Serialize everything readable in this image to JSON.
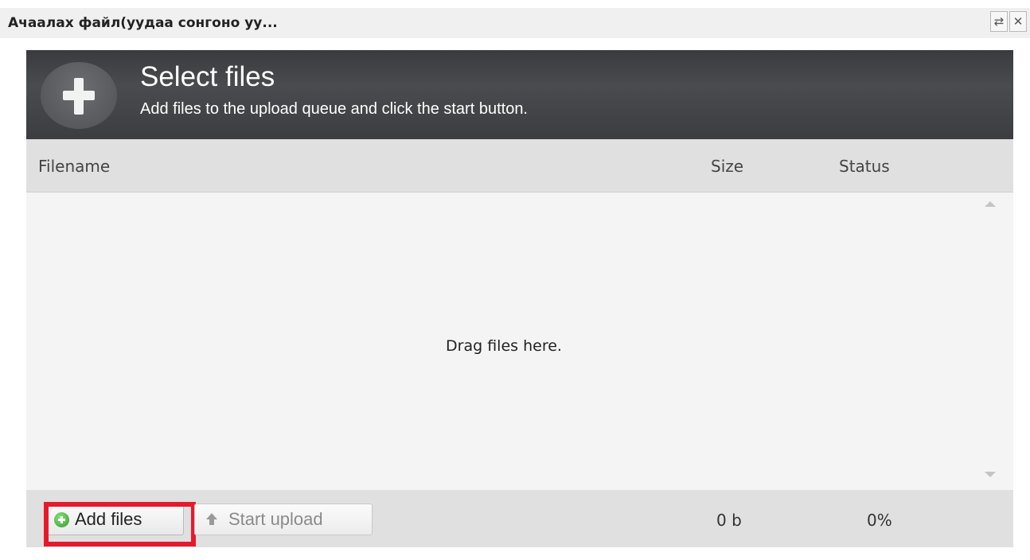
{
  "window": {
    "title": "Ачаалах файл(уудаа сонгоно уу...",
    "refresh_icon": "⇄",
    "close_icon": "✕"
  },
  "header": {
    "title": "Select files",
    "subtitle": "Add files to the upload queue and click the start button.",
    "icon": "plus-icon"
  },
  "columns": {
    "filename": "Filename",
    "size": "Size",
    "status": "Status"
  },
  "filelist": {
    "drop_text": "Drag files here."
  },
  "footer": {
    "add_files_label": "Add files",
    "start_upload_label": "Start upload",
    "total_size": "0 b",
    "total_status": "0%"
  },
  "colors": {
    "header_bg": "#3c3d40",
    "highlight": "#e8192c",
    "add_icon": "#2f9a2a"
  }
}
